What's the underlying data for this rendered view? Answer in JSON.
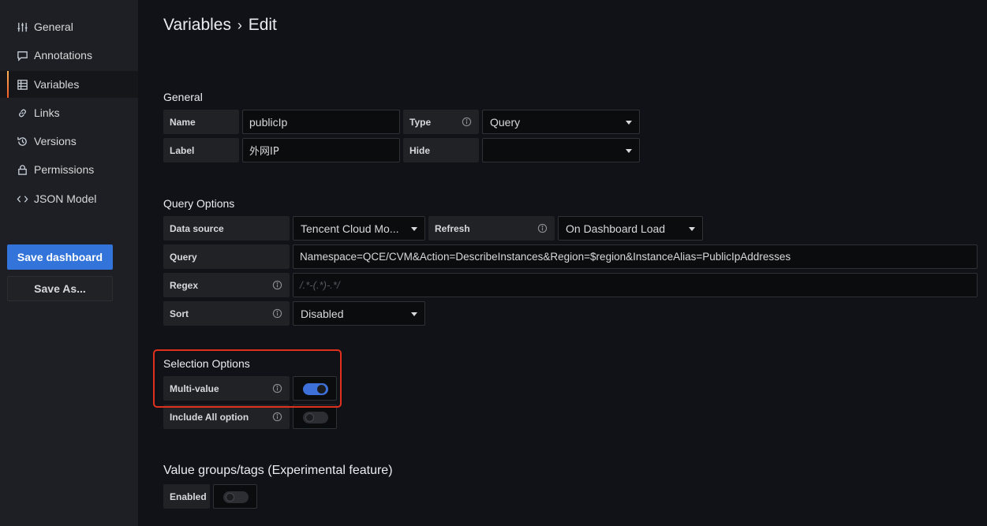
{
  "sidebar": {
    "items": [
      {
        "label": "General",
        "icon": "sliders-icon"
      },
      {
        "label": "Annotations",
        "icon": "comment-icon"
      },
      {
        "label": "Variables",
        "icon": "table-icon"
      },
      {
        "label": "Links",
        "icon": "link-icon"
      },
      {
        "label": "Versions",
        "icon": "history-icon"
      },
      {
        "label": "Permissions",
        "icon": "lock-icon"
      },
      {
        "label": "JSON Model",
        "icon": "code-icon"
      }
    ],
    "active_item": "Variables",
    "save_dashboard_label": "Save dashboard",
    "save_as_label": "Save As..."
  },
  "header": {
    "title": "Variables",
    "separator": "›",
    "subtitle": "Edit"
  },
  "general": {
    "title": "General",
    "name_label": "Name",
    "name_value": "publicIp",
    "type_label": "Type",
    "type_value": "Query",
    "label_label": "Label",
    "label_value": "外网IP",
    "hide_label": "Hide",
    "hide_value": ""
  },
  "query_options": {
    "title": "Query Options",
    "datasource_label": "Data source",
    "datasource_value": "Tencent Cloud Mo...",
    "refresh_label": "Refresh",
    "refresh_value": "On Dashboard Load",
    "query_label": "Query",
    "query_value": "Namespace=QCE/CVM&Action=DescribeInstances&Region=$region&InstanceAlias=PublicIpAddresses",
    "regex_label": "Regex",
    "regex_placeholder": "/.*-(.*)-.*/",
    "sort_label": "Sort",
    "sort_value": "Disabled"
  },
  "selection_options": {
    "title": "Selection Options",
    "multi_value_label": "Multi-value",
    "multi_value_enabled": true,
    "include_all_label": "Include All option",
    "include_all_enabled": false
  },
  "value_groups": {
    "title": "Value groups/tags (Experimental feature)",
    "enabled_label": "Enabled",
    "enabled": false
  },
  "colors": {
    "accent_blue": "#3274d9",
    "highlight_red": "#e0301e",
    "active_bar": "#f05a28"
  }
}
